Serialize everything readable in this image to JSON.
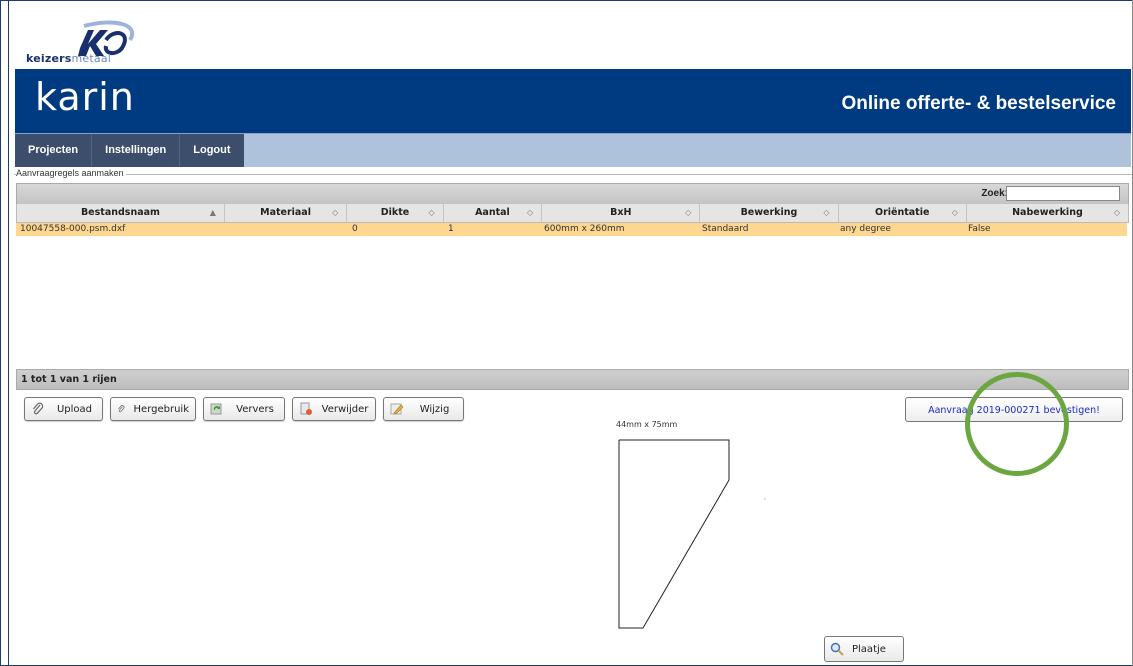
{
  "logo": {
    "word_bold": "keizers",
    "word_light": "metaal"
  },
  "banner": {
    "brand": "karin",
    "tagline": "Online offerte- & bestelservice"
  },
  "nav": [
    "Projecten",
    "Instellingen",
    "Logout"
  ],
  "section": {
    "legend": "Aanvraagregels aanmaken"
  },
  "grid": {
    "search_label": "Zoek:",
    "search_value": "",
    "columns": [
      "Bestandsnaam",
      "Materiaal",
      "Dikte",
      "Aantal",
      "BxH",
      "Bewerking",
      "Oriëntatie",
      "Nabewerking"
    ],
    "sort_indicator": "▲",
    "sortable_indicator": "◇",
    "rows": [
      [
        "10047558-000.psm.dxf",
        "",
        "0",
        "1",
        "600mm x 260mm",
        "Standaard",
        "any degree",
        "False"
      ]
    ],
    "footer": "1 tot 1 van 1 rijen"
  },
  "buttons": {
    "upload": "Upload",
    "hergebruik": "Hergebruik",
    "ververs": "Ververs",
    "verwijder": "Verwijder",
    "wijzig": "Wijzig",
    "confirm": "Aanvraag 2019-000271 bevestigen!",
    "plaatje": "Plaatje"
  },
  "preview": {
    "dimensions": "44mm x 75mm"
  },
  "colors": {
    "banner": "#003a80",
    "nav": "#afc2dc",
    "row_highlight": "#fdd68f",
    "highlight_ring": "#6aa740"
  }
}
